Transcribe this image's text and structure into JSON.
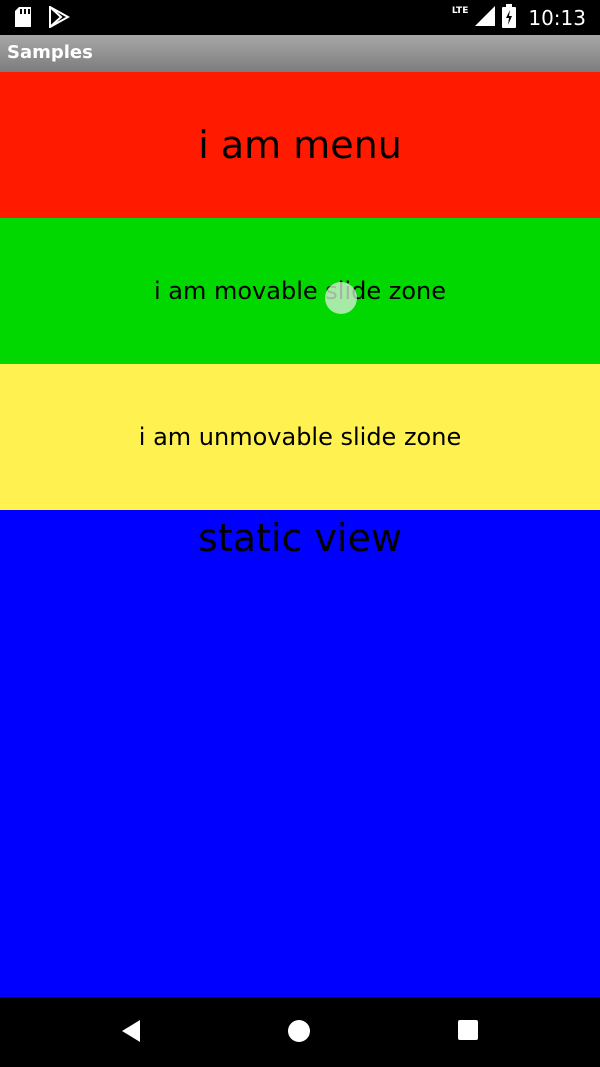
{
  "status_bar": {
    "time": "10:13",
    "network_label": "LTE",
    "icons": [
      "sd-card-icon",
      "play-store-icon",
      "signal-icon",
      "battery-charging-icon"
    ]
  },
  "app_bar": {
    "title": "Samples"
  },
  "zones": {
    "menu": {
      "label": "i am menu",
      "color": "#ff1a00"
    },
    "movable": {
      "label": "i am movable slide zone",
      "color": "#00d800"
    },
    "unmovable": {
      "label": "i am unmovable slide zone",
      "color": "#fff250"
    },
    "static": {
      "label": "static view",
      "color": "#0000ff"
    }
  },
  "nav_bar": {
    "icons": [
      "back-icon",
      "home-icon",
      "recents-icon"
    ]
  }
}
